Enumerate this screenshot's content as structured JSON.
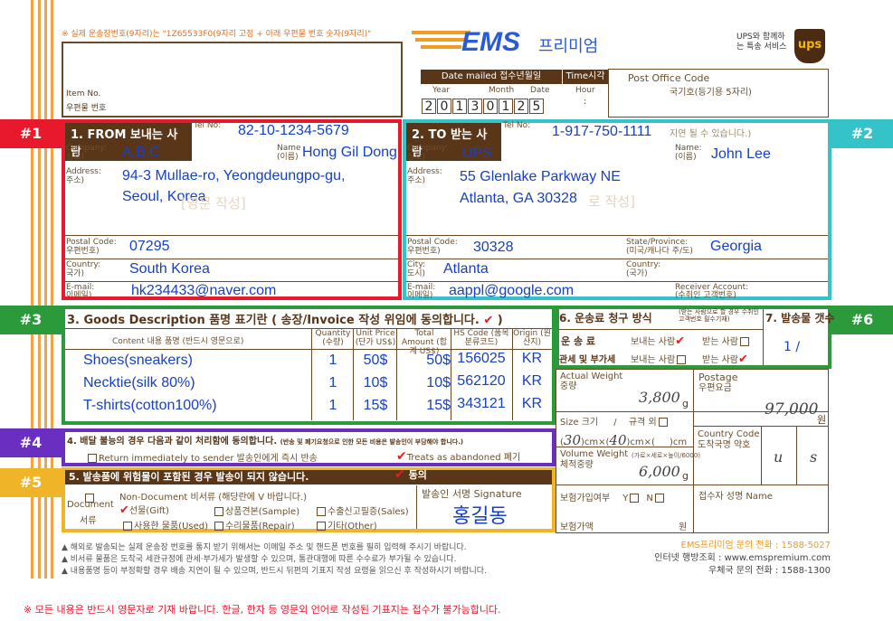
{
  "top_note": "※ 실제 운송장번호(9자리)는 \"1Z65533F0(9자리 고정 + 아래 우편물 번호 숫자(9자리)\"",
  "brand": {
    "ems": "EMS",
    "premium": "프리미엄",
    "ups_note": "UPS와 함께하는 특송 서비스",
    "ups_logo": "ups"
  },
  "item_no_label": "Item No.",
  "item_no_ko": "우편물 번호",
  "date_mailed": {
    "label": "Date mailed 접수년월일",
    "year_label": "Year",
    "month_label": "Month",
    "date_label": "Date",
    "digits": [
      "2",
      "0",
      "1",
      "3",
      "0",
      "1",
      "2",
      "5"
    ]
  },
  "time": {
    "label": "Time시각",
    "hour_label": "Hour",
    "sep": ":"
  },
  "post_office": {
    "label": "Post Office Code",
    "sub": "국기호(등기용 5자리)"
  },
  "tags": [
    "#1",
    "#2",
    "#3",
    "#4",
    "#5",
    "#6"
  ],
  "from": {
    "header": "1. FROM 보내는 사람",
    "tel_label": "Tel No:",
    "tel": "82-10-1234-5679",
    "company_label": "Company:",
    "company_ko": "상호)",
    "company": "A.B.C",
    "name_label": "Name",
    "name_ko": "(이름)",
    "name": "Hong Gil Dong",
    "address_label": "Address:",
    "address_ko": "주소)",
    "address1": "94-3 Mullae-ro, Yeongdeungpo-gu,",
    "address2": "Seoul, Korea",
    "watermark": "[영문 작성]",
    "postal_label": "Postal Code:",
    "postal_ko": "우편번호)",
    "postal": "07295",
    "country_label": "Country:",
    "country_ko": "국가)",
    "country": "South Korea",
    "email_label": "E-mail:",
    "email_ko": "이메일)",
    "email": "hk234433@naver.com"
  },
  "to": {
    "header": "2. TO 받는 사람",
    "tel_label": "Tel No:",
    "tel": "1-917-750-1111",
    "tel_note": "지연 될 수 있습니다.)",
    "company_label": "Company:",
    "company_ko": "상호)",
    "company": "UPS",
    "name_label": "Name:",
    "name_ko": "(이름)",
    "name": "John Lee",
    "address_label": "Address:",
    "address_ko": "주소)",
    "address1": "55 Glenlake Parkway NE",
    "address2": "Atlanta, GA 30328",
    "watermark": "로 작성]",
    "postal_label": "Postal Code:",
    "postal_ko": "우편번호)",
    "postal": "30328",
    "state_label": "State/Province:",
    "state_ko": "(미국/캐나다 주/도)",
    "state": "Georgia",
    "city_label": "City:",
    "city_ko": "도시)",
    "city": "Atlanta",
    "country_label": "Country:",
    "country_ko": "(국가)",
    "email_label": "E-mail:",
    "email_ko": "이메일)",
    "email": "aappl@google.com",
    "receiver_label": "Receiver Account:",
    "receiver_ko": "(수취인 고객번호)"
  },
  "goods": {
    "header": "3. Goods Description 품명 표기란 ( 송장/Invoice 작성 위임에 동의합니다.",
    "check": "✔",
    "close": ")",
    "cols": [
      "Content 내용 품명 (반드시 영문으로)",
      "Quantity (수량)",
      "Unit Price (단가 US$)",
      "Total Amount (합계 US$)",
      "HS Code (품목분류코드)",
      "Origin (원산지)"
    ],
    "rows": [
      {
        "content": "Shoes(sneakers)",
        "qty": "1",
        "unit": "50$",
        "total": "50$",
        "hs": "156025",
        "origin": "KR"
      },
      {
        "content": "Necktie(silk 80%)",
        "qty": "1",
        "unit": "10$",
        "total": "10$",
        "hs": "562120",
        "origin": "KR"
      },
      {
        "content": "T-shirts(cotton100%)",
        "qty": "1",
        "unit": "15$",
        "total": "15$",
        "hs": "343121",
        "origin": "KR"
      }
    ]
  },
  "undeliverable": {
    "header": "4. 배달 불능의 경우 다음과 같이 처리함에 동의합니다.",
    "note": "(반송 및 폐기요청으로 인한 모든 비용은 발송인이 부담해야 합니다.)",
    "opt1": "Return immediately to sender 발송인에게 즉시 반송",
    "opt2": "Treats as abandoned 폐기"
  },
  "dangerous": {
    "header": "5. 발송품에 위험물이 포함된 경우 발송이 되지 않습니다.",
    "agree": "동의",
    "document": "Document",
    "document_ko": "서류",
    "nondoc": "Non-Document 비서류 (해당란에 V 바랍니다.)",
    "opts": [
      "선물(Gift)",
      "상품견본(Sample)",
      "수출신고필증(Sales)",
      "사용한 물품(Used)",
      "수리물품(Repair)",
      "기타(Other)"
    ],
    "sig_label": "발송인 서명 Signature",
    "signature": "홍길동"
  },
  "fee": {
    "header": "6. 운송료 청구 방식",
    "sub": "(받는 사람으로 할 경우 수취인 고객번호 필수기재)",
    "row1": "운 송 료",
    "row2": "관세 및 부가세",
    "sender": "보내는 사람",
    "receiver": "받는 사람"
  },
  "count": {
    "header": "7. 발송물 갯수",
    "value": "1 /"
  },
  "weight": {
    "label": "Actual Weight",
    "ko": "중량",
    "value": "3,800",
    "unit": "g"
  },
  "postage": {
    "label": "Postage",
    "ko": "우편요금",
    "value": "97,000",
    "unit": "원"
  },
  "size": {
    "label": "Size 크기",
    "sep": "/",
    "sub": "규격 외",
    "val1": "30",
    "val2": "40",
    "u1": ")cm×(",
    "u2": ")cm×(",
    "u3": ")cm"
  },
  "country_code": {
    "label": "Country Code",
    "ko": "도착국명 약호",
    "c1": "u",
    "c2": "s"
  },
  "vol_weight": {
    "label": "Volume Weight",
    "note": "(가로×세로×높이/6000)",
    "ko": "체적중량",
    "value": "6,000",
    "unit": "g"
  },
  "insurance": {
    "label": "보험가입여부",
    "y": "Y",
    "n": "N",
    "amount": "보험가액",
    "won": "원"
  },
  "receiver_sig": {
    "label": "접수자 성명 Name"
  },
  "notes": [
    "▲ 해외로 발송되는 실제 운송장 번호를 통지 받기 위해서는 이메일 주소 및 핸드폰 번호를 필히 입력해 주시기 바랍니다.",
    "▲ 비서류 물품은 도착국 세관규정에 관세·부가세가 발생할 수 있으며, 통관대행에 따른 수수료가 부가될 수 있습니다.",
    "▲ 내용품명 등이 부정확할 경우 배송 지연이 될 수 있으며, 반드시 뒤편의 기표지 작성 요령을 읽으신 후 작성하시기 바랍니다."
  ],
  "contacts": [
    "EMS프리미엄 문의 전화 : 1588-5027",
    "인터넷 행방조회 : www.emspremium.com",
    "우체국 문의 전화 : 1588-1300"
  ],
  "footer": "※ 모든 내용은 반드시 영문자로 기재 바랍니다. 한글, 한자 등 영문외 언어로 작성된 기표지는 접수가 불가능합니다.",
  "colors": {
    "tag1": "#e8192c",
    "tag2": "#33c3c8",
    "tag3": "#2a9a3a",
    "tag4": "#6a2fc0",
    "tag5": "#f0b428",
    "tag6": "#2a9a3a",
    "brown": "#5a3618",
    "ems_orange": "#f29a22",
    "ems_blue": "#2a5bd7"
  }
}
